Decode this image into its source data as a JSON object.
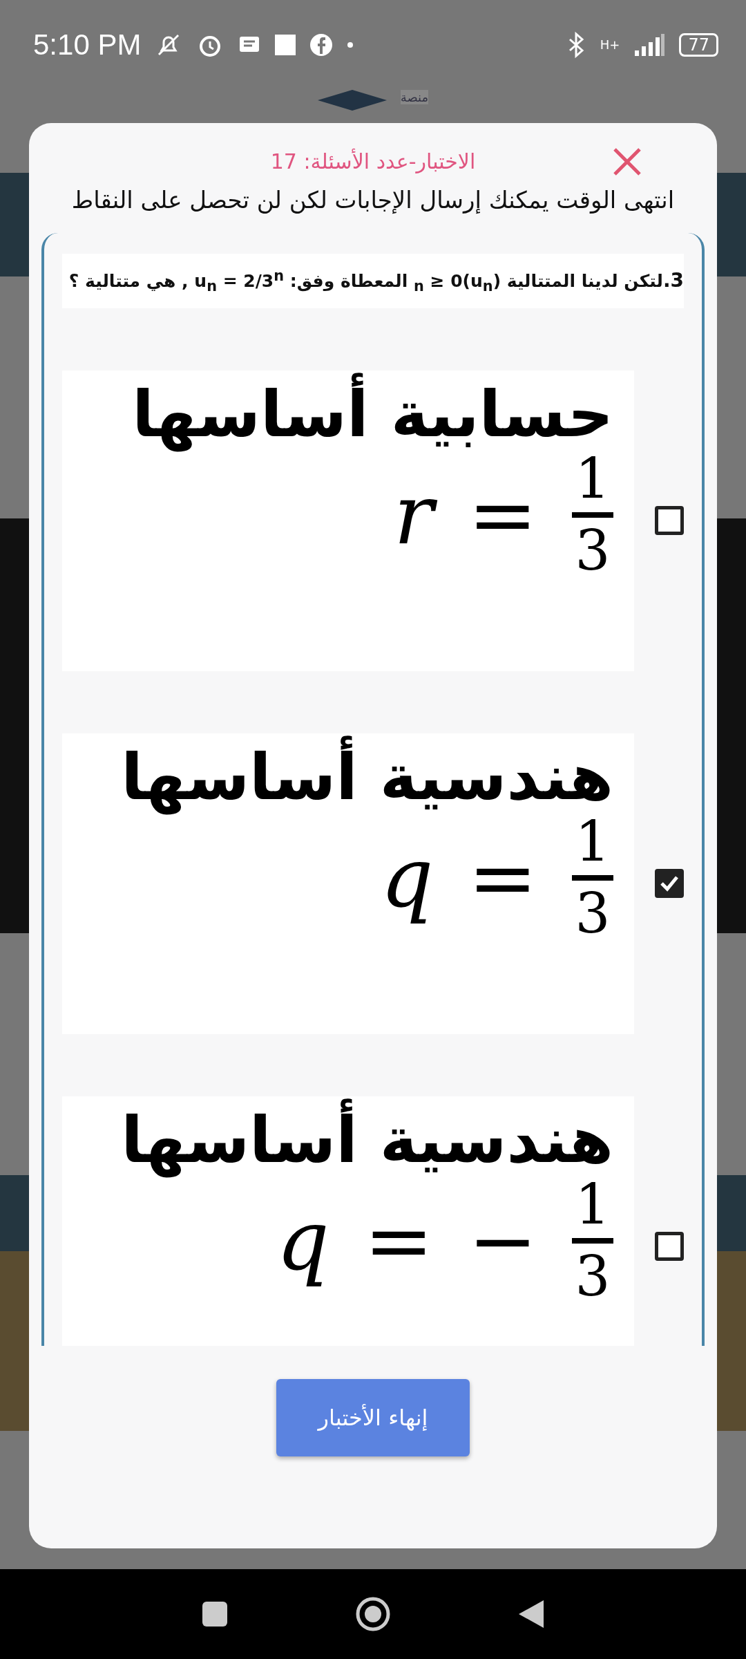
{
  "status_bar": {
    "time": "5:10 PM",
    "network": "H+",
    "battery": "77"
  },
  "background": {
    "logo_text": "منصة"
  },
  "dialog": {
    "title": "الاختبار-عدد الأسئلة: 17",
    "message": "انتهى الوقت يمكنك إرسال الإجابات لكن لن تحصل على النقاط",
    "question": {
      "number": "3.",
      "text": "لتكن لدينا المتتالية (u$_{n}$)$_{n}$ ≥ 0 المعطاة وفق: u$_{n}$ = 2/3$^{n}$ , هي متتالية ؟"
    },
    "options": [
      {
        "label": "حسابية أساسها",
        "variable": "r",
        "relation": "=",
        "numerator": "1",
        "denominator": "3",
        "checked": false
      },
      {
        "label": "هندسية أساسها",
        "variable": "q",
        "relation": "=",
        "numerator": "1",
        "denominator": "3",
        "checked": true
      },
      {
        "label": "هندسية أساسها",
        "variable": "q",
        "relation": "=",
        "sign": "−",
        "numerator": "1",
        "denominator": "3",
        "checked": false
      }
    ],
    "finish_button": "إنهاء الأختبار"
  }
}
